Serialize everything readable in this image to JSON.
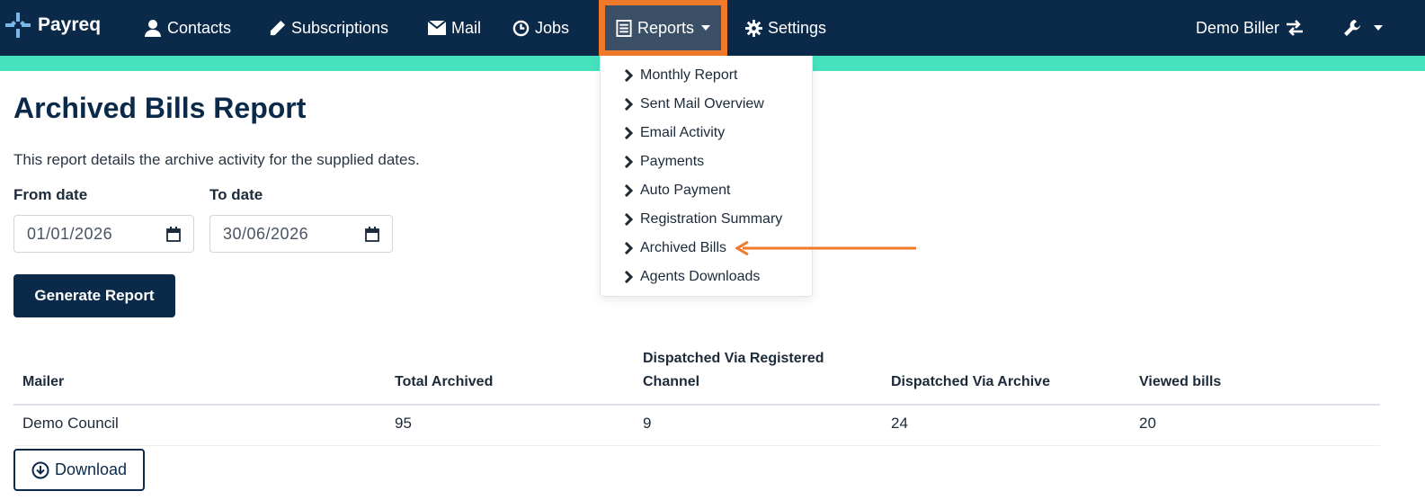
{
  "navbar": {
    "brand": "Payreq",
    "items": [
      {
        "label": "Contacts",
        "icon": "person-icon"
      },
      {
        "label": "Subscriptions",
        "icon": "pencil-icon"
      },
      {
        "label": "Mail",
        "icon": "envelope-icon"
      },
      {
        "label": "Jobs",
        "icon": "clock-icon"
      },
      {
        "label": "Reports",
        "icon": "report-icon"
      },
      {
        "label": "Settings",
        "icon": "gear-icon"
      }
    ],
    "account": {
      "label": "Demo Biller",
      "icon": "swap-icon"
    },
    "tools_icon": "wrench-icon"
  },
  "reports_menu": {
    "items": [
      "Monthly Report",
      "Sent Mail Overview",
      "Email Activity",
      "Payments",
      "Auto Payment",
      "Registration Summary",
      "Archived Bills",
      "Agents Downloads"
    ]
  },
  "page": {
    "title": "Archived Bills Report",
    "description": "This report details the archive activity for the supplied dates.",
    "from_label": "From date",
    "from_value": "01/01/2026",
    "to_label": "To date",
    "to_value": "30/06/2026",
    "generate_label": "Generate Report",
    "download_label": "Download"
  },
  "table": {
    "headers": [
      "Mailer",
      "Total Archived",
      "Dispatched Via Registered",
      "Channel",
      "Dispatched Via Archive",
      "Viewed bills"
    ],
    "rows": [
      [
        "Demo Council",
        "95",
        "9",
        "24",
        "20"
      ]
    ]
  },
  "colors": {
    "navbar": "#0b2a4a",
    "accent": "#46e2bd",
    "highlight": "#f07a2b"
  }
}
